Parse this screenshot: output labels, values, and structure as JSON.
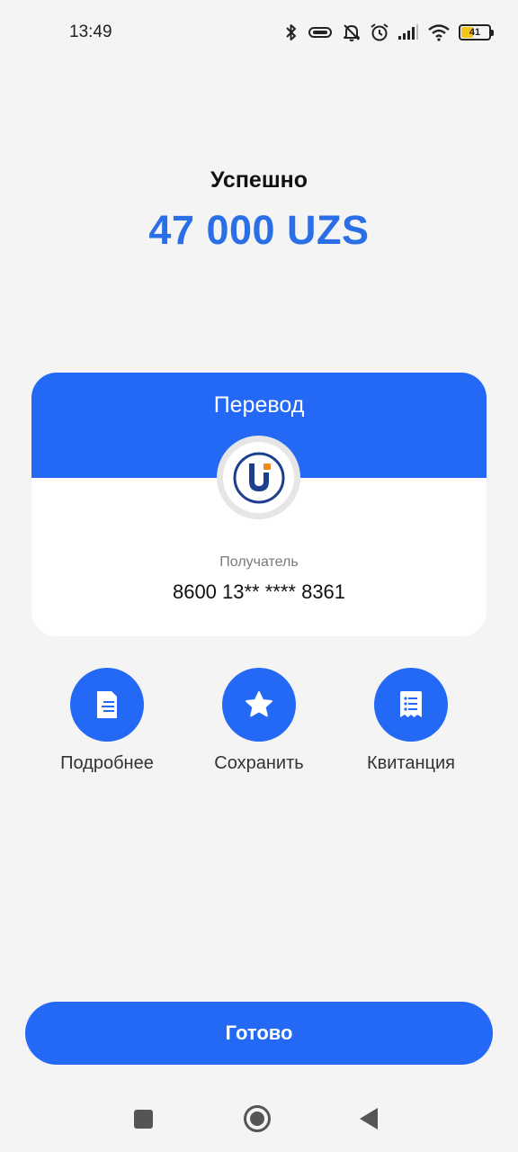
{
  "status_bar": {
    "time": "13:49",
    "battery_level": 41,
    "battery_text": "41",
    "icons": [
      "bluetooth-icon",
      "vibrate-icon",
      "mute-icon",
      "alarm-icon",
      "signal-icon",
      "wifi-icon",
      "battery-icon"
    ]
  },
  "header": {
    "status_text": "Успешно",
    "amount": "47 000 UZS"
  },
  "card": {
    "title": "Перевод",
    "logo_icon": "uzcard-logo",
    "recipient_label": "Получатель",
    "recipient_value": "8600 13** **** 8361"
  },
  "actions": [
    {
      "label": "Подробнее",
      "icon": "document-icon"
    },
    {
      "label": "Сохранить",
      "icon": "star-icon"
    },
    {
      "label": "Квитанция",
      "icon": "receipt-icon"
    }
  ],
  "done_button": "Готово",
  "nav": [
    "recent-apps-icon",
    "home-icon",
    "back-icon"
  ],
  "colors": {
    "accent": "#2469f5",
    "amount": "#2a6fe6",
    "background": "#f4f4f4",
    "logo_orange": "#f08a1c",
    "logo_navy": "#1d3f8f"
  }
}
